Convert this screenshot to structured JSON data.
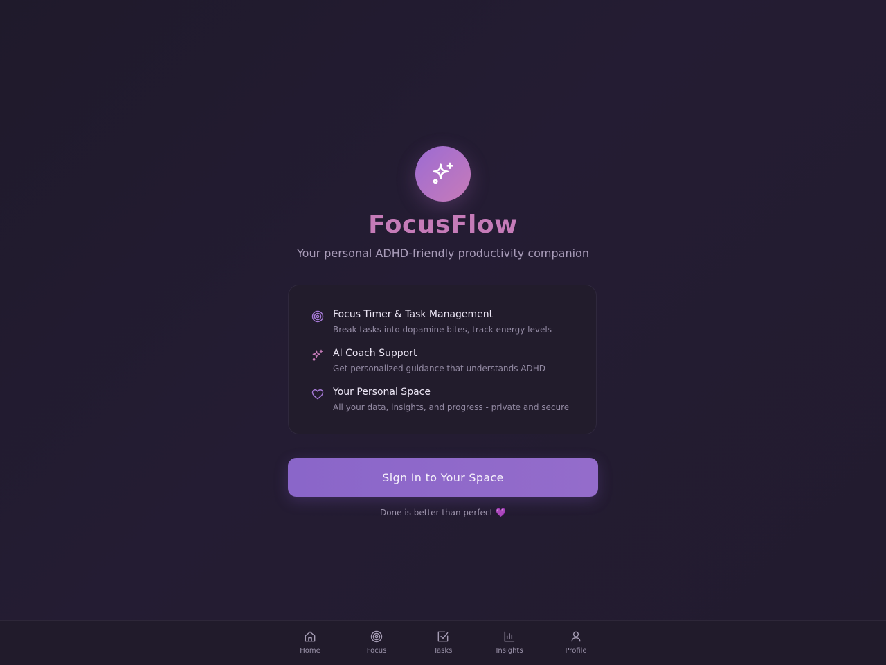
{
  "app": {
    "title": "FocusFlow",
    "tagline": "Your personal ADHD-friendly productivity companion",
    "logo_icon": "sparkles-icon"
  },
  "features": [
    {
      "icon": "target-icon",
      "title": "Focus Timer & Task Management",
      "description": "Break tasks into dopamine bites, track energy levels"
    },
    {
      "icon": "sparkles-icon",
      "title": "AI Coach Support",
      "description": "Get personalized guidance that understands ADHD"
    },
    {
      "icon": "heart-icon",
      "title": "Your Personal Space",
      "description": "All your data, insights, and progress - private and secure"
    }
  ],
  "signin": {
    "label": "Sign In to Your Space"
  },
  "motto": {
    "text": "Done is better than perfect",
    "emoji": "💜"
  },
  "nav": {
    "items": [
      {
        "label": "Home",
        "icon": "home-icon"
      },
      {
        "label": "Focus",
        "icon": "target-icon"
      },
      {
        "label": "Tasks",
        "icon": "checkbox-icon"
      },
      {
        "label": "Insights",
        "icon": "bar-chart-icon"
      },
      {
        "label": "Profile",
        "icon": "user-icon"
      }
    ]
  },
  "colors": {
    "background": "#221b2e",
    "accent_pink": "#c57bb8",
    "accent_purple": "#8a66c9",
    "muted_text": "#a99cb9"
  }
}
